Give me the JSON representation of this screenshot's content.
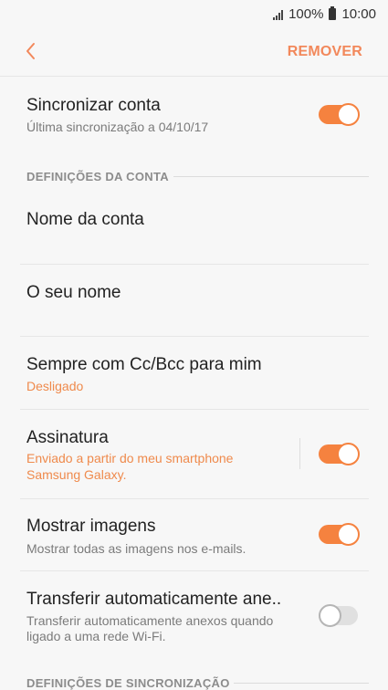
{
  "status": {
    "battery": "100%",
    "time": "10:00"
  },
  "app_bar": {
    "remove_label": "REMOVER"
  },
  "sync_account": {
    "title": "Sincronizar conta",
    "subtitle": "Última sincronização a 04/10/17",
    "enabled": true
  },
  "section_account": {
    "header": "DEFINIÇÕES DA CONTA"
  },
  "account_name": {
    "title": "Nome da conta"
  },
  "your_name": {
    "title": "O seu nome"
  },
  "always_cc": {
    "title": "Sempre com Cc/Bcc para mim",
    "subtitle": "Desligado"
  },
  "signature": {
    "title": "Assinatura",
    "subtitle_line1": "Enviado a partir do meu smartphone",
    "subtitle_line2": "Samsung Galaxy.",
    "enabled": true
  },
  "show_images": {
    "title": "Mostrar imagens",
    "subtitle": "Mostrar todas as imagens nos e-mails.",
    "enabled": true
  },
  "auto_download": {
    "title": "Transferir automaticamente ane..",
    "subtitle_line1": "Transferir automaticamente anexos quando",
    "subtitle_line2": "ligado a uma rede Wi-Fi.",
    "enabled": false
  },
  "section_sync": {
    "header": "DEFINIÇÕES DE SINCRONIZAÇÃO"
  },
  "colors": {
    "accent": "#f5823f",
    "accent_text": "#ef8a4c"
  }
}
